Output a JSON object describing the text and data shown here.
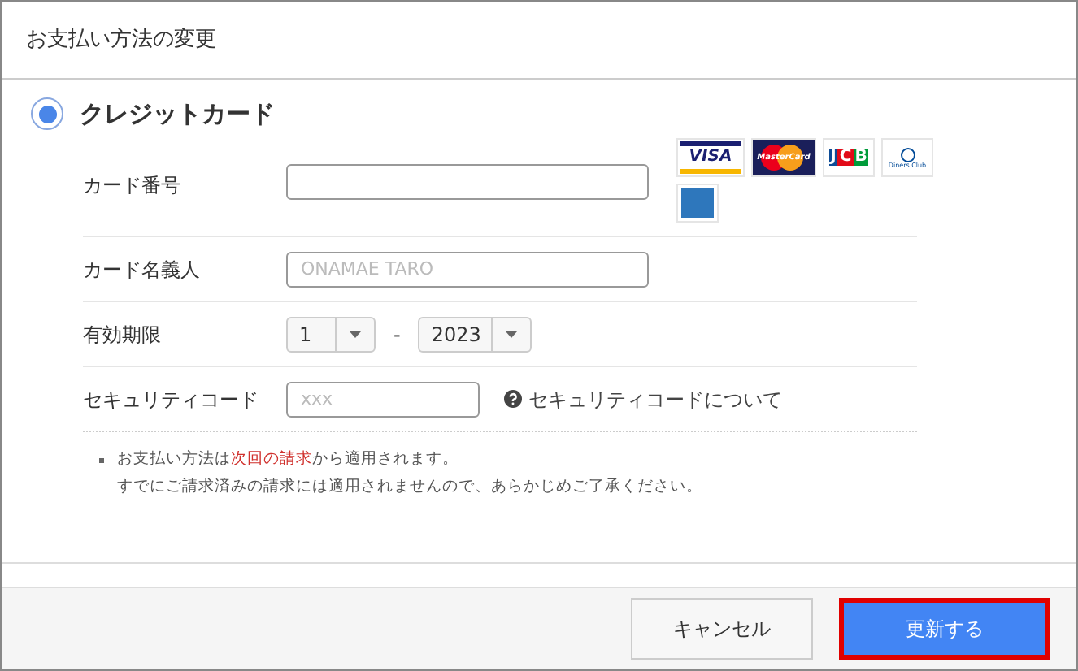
{
  "dialog": {
    "title": "お支払い方法の変更"
  },
  "payment_method": {
    "label": "クレジットカード",
    "selected": true
  },
  "card_brands": [
    {
      "kind": "visa",
      "label": "VISA"
    },
    {
      "kind": "mastercard",
      "label": "MasterCard"
    },
    {
      "kind": "jcb",
      "label": "JCB"
    },
    {
      "kind": "diners",
      "label": "Diners Club"
    },
    {
      "kind": "amex"
    }
  ],
  "fields": [
    {
      "kind": "text",
      "label": "カード番号"
    },
    {
      "kind": "text",
      "label": "カード名義人",
      "placeholder": "ONAMAE TARO"
    },
    {
      "kind": "expiry",
      "label": "有効期限",
      "month": "1",
      "separator": "-",
      "year": "2023"
    },
    {
      "kind": "security",
      "label": "セキュリティコード",
      "placeholder": "xxx",
      "help_link": "セキュリティコードについて"
    }
  ],
  "notes": [
    {
      "parts": [
        {
          "kind": "plain",
          "text": "お支払い方法は"
        },
        {
          "kind": "link",
          "text": "次回の請求"
        },
        {
          "kind": "plain",
          "text": "から適用されます。"
        }
      ],
      "line2": "すでにご請求済みの請求には適用されませんので、あらかじめご了承ください。"
    }
  ],
  "buttons": [
    {
      "kind": "secondary",
      "label": "キャンセル",
      "highlighted": false
    },
    {
      "kind": "primary",
      "label": "更新する",
      "highlighted": true
    }
  ]
}
